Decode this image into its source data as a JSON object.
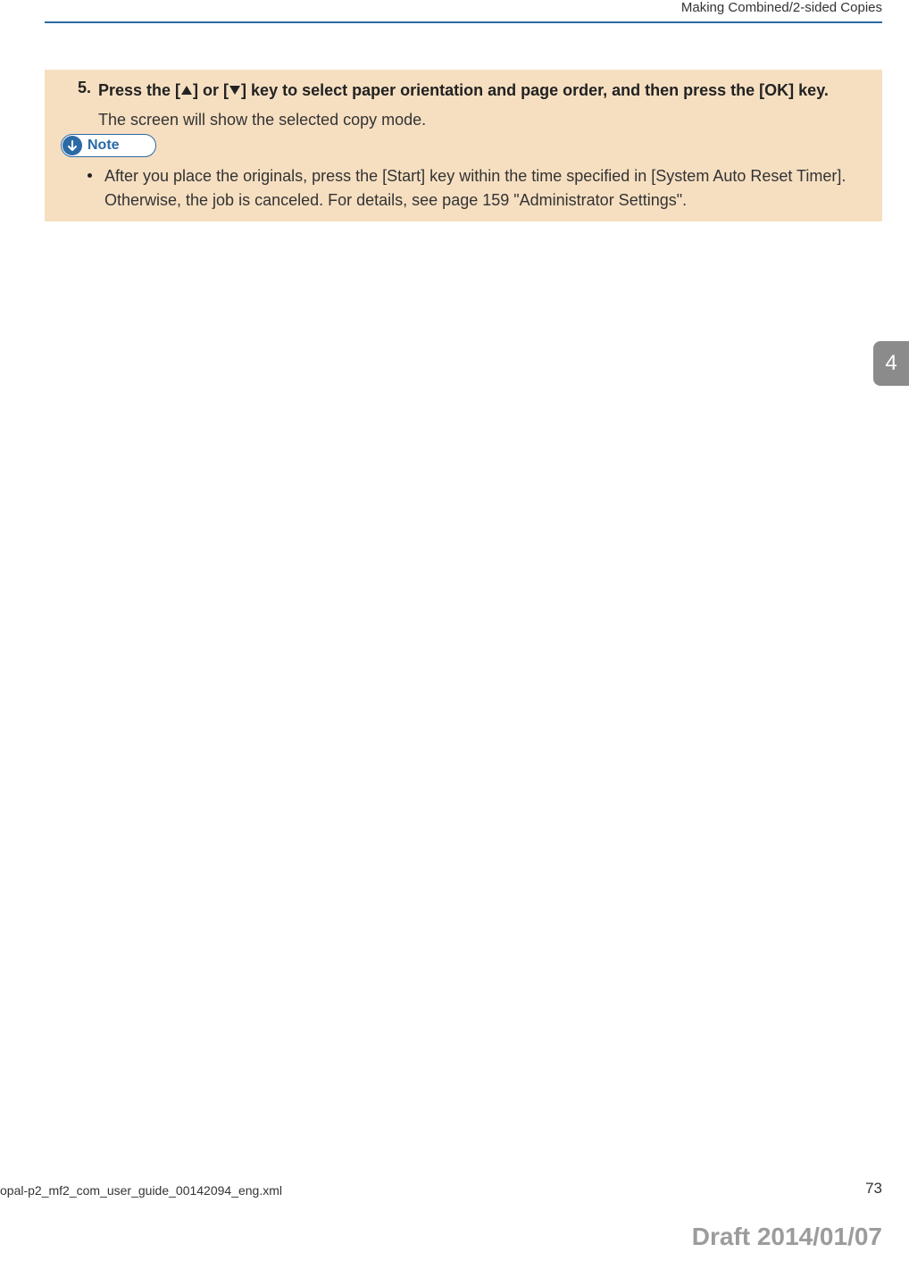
{
  "header": {
    "title": "Making Combined/2-sided Copies"
  },
  "step": {
    "num": "5.",
    "text_before": "Press the [",
    "text_mid": "] or [",
    "text_after": "] key to select paper orientation and page order, and then press the [OK] key.",
    "subtext": "The screen will show the selected copy mode."
  },
  "note": {
    "label": "Note",
    "body": "After you place the originals, press the [Start] key within the time specified in [System Auto Reset Timer]. Otherwise, the job is canceled. For details, see page 159 \"Administrator Settings\"."
  },
  "side_tab": "4",
  "footer": {
    "file": "opal-p2_mf2_com_user_guide_00142094_eng.xml",
    "page": "73",
    "draft": "Draft 2014/01/07"
  }
}
